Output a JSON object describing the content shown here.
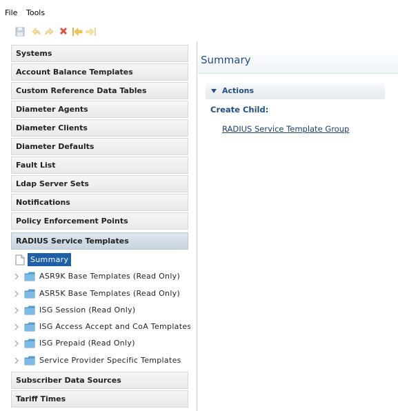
{
  "menu": {
    "file": "File",
    "tools": "Tools"
  },
  "toolbar": {
    "icons": [
      "save-icon",
      "undo-icon",
      "redo-icon",
      "delete-icon",
      "back-icon",
      "forward-icon"
    ]
  },
  "sidebar": {
    "headers_top": [
      "Systems",
      "Account Balance Templates",
      "Custom Reference Data Tables",
      "Diameter Agents",
      "Diameter Clients",
      "Diameter Defaults",
      "Fault List",
      "Ldap Server Sets",
      "Notifications",
      "Policy Enforcement Points"
    ],
    "active_header": "RADIUS Service Templates",
    "summary_item": "Summary",
    "tree_items": [
      "ASR9K Base Templates (Read Only)",
      "ASR5K Base Templates (Read Only)",
      "ISG Session (Read Only)",
      "ISG Access Accept and CoA Templates",
      "ISG Prepaid (Read Only)",
      "Service Provider Specific Templates"
    ],
    "headers_bottom": [
      "Subscriber Data Sources",
      "Tariff Times"
    ]
  },
  "main": {
    "title": "Summary",
    "actions_label": "Actions",
    "create_child_label": "Create Child:",
    "child_link": "RADIUS Service Template Group"
  },
  "colors": {
    "accent": "#1f4e87",
    "selection": "#1f5fa8",
    "folder": "#5aa2d8"
  }
}
